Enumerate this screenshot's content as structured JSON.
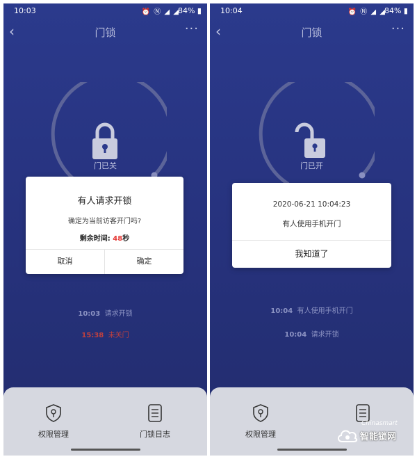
{
  "screen_left": {
    "status": {
      "time": "10:03",
      "battery": "84%"
    },
    "appbar": {
      "title": "门锁"
    },
    "lock": {
      "state_label": "门已关"
    },
    "dialog": {
      "title": "有人请求开锁",
      "message": "确定为当前访客开门吗?",
      "countdown_label": "剩余时间: ",
      "countdown_value": "48",
      "countdown_unit": "秒",
      "cancel_label": "取消",
      "confirm_label": "确定"
    },
    "log": [
      {
        "time": "10:03",
        "text": "请求开锁"
      },
      {
        "time": "15:38",
        "text": "未关门"
      }
    ],
    "tabs": {
      "permissions": "权限管理",
      "door_log": "门锁日志"
    }
  },
  "screen_right": {
    "status": {
      "time": "10:04",
      "battery": "84%"
    },
    "appbar": {
      "title": "门锁"
    },
    "lock": {
      "state_label": "门已开"
    },
    "dialog": {
      "datetime": "2020-06-21 10:04:23",
      "message": "有人使用手机开门",
      "ok_label": "我知道了"
    },
    "log": [
      {
        "time": "10:04",
        "text": "有人使用手机开门"
      },
      {
        "time": "10:04",
        "text": "请求开锁"
      }
    ],
    "tabs": {
      "permissions": "权限管理"
    }
  },
  "watermark": {
    "brand": "智能锁网",
    "domain": "Chinasmart"
  },
  "colors": {
    "background": "#27337f",
    "accent_red": "#e53935",
    "sheet": "#d6d8e0"
  }
}
